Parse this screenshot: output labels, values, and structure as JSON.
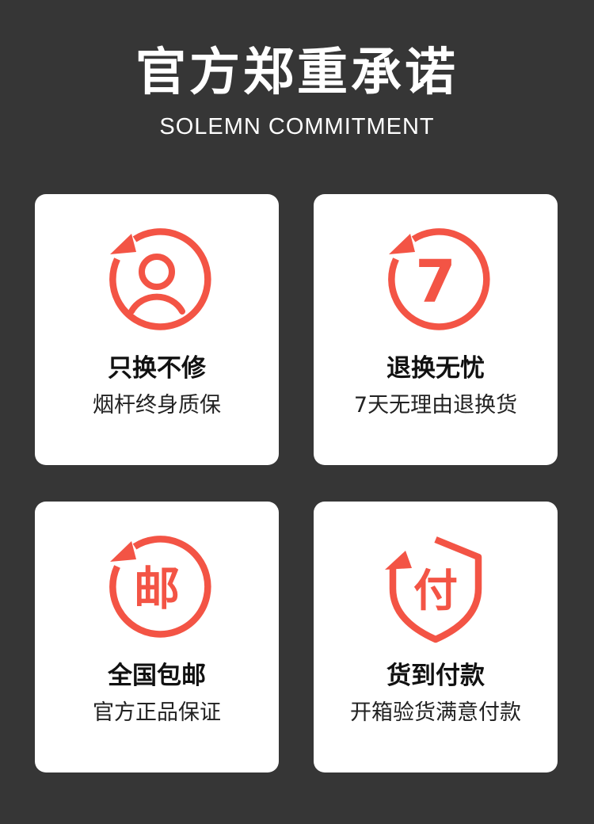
{
  "header": {
    "title": "官方郑重承诺",
    "subtitle": "SOLEMN COMMITMENT"
  },
  "accent_color": "#F35445",
  "cards": [
    {
      "icon": "user-icon",
      "glyph": "",
      "title": "只换不修",
      "desc": "烟杆终身质保"
    },
    {
      "icon": "seven-icon",
      "glyph": "7",
      "title": "退换无忧",
      "desc": "7天无理由退换货"
    },
    {
      "icon": "mail-icon",
      "glyph": "邮",
      "title": "全国包邮",
      "desc": "官方正品保证"
    },
    {
      "icon": "shield-icon",
      "glyph": "付",
      "title": "货到付款",
      "desc": "开箱验货满意付款"
    }
  ]
}
